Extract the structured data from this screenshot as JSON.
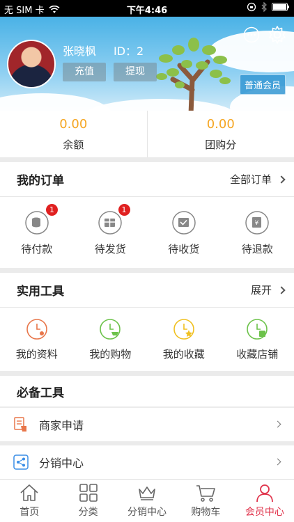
{
  "status_bar": {
    "carrier": "无 SIM 卡",
    "time": "下午4:46"
  },
  "profile": {
    "name": "张晓枫",
    "id_label": "ID：2",
    "recharge_label": "充值",
    "withdraw_label": "提现",
    "member_level": "普通会员"
  },
  "balance": [
    {
      "value": "0.00",
      "label": "余额"
    },
    {
      "value": "0.00",
      "label": "团购分"
    }
  ],
  "orders": {
    "title": "我的订单",
    "more_label": "全部订单",
    "items": [
      {
        "label": "待付款",
        "icon": "wallet-icon",
        "badge": "1"
      },
      {
        "label": "待发货",
        "icon": "package-icon",
        "badge": "1"
      },
      {
        "label": "待收货",
        "icon": "receive-icon",
        "badge": ""
      },
      {
        "label": "待退款",
        "icon": "refund-icon",
        "badge": ""
      }
    ]
  },
  "tools": {
    "title": "实用工具",
    "more_label": "展开",
    "items": [
      {
        "label": "我的资料",
        "icon": "profile-icon",
        "color": "#e8764a"
      },
      {
        "label": "我的购物",
        "icon": "shopping-icon",
        "color": "#6cc24a"
      },
      {
        "label": "我的收藏",
        "icon": "favorite-icon",
        "color": "#f0c020"
      },
      {
        "label": "收藏店铺",
        "icon": "store-icon",
        "color": "#6cc24a"
      }
    ]
  },
  "essentials": {
    "title": "必备工具",
    "items": [
      {
        "label": "商家申请",
        "icon": "merchant-icon"
      },
      {
        "label": "分销中心",
        "icon": "distribution-icon"
      }
    ]
  },
  "tabbar": {
    "items": [
      {
        "label": "首页",
        "icon": "home-icon"
      },
      {
        "label": "分类",
        "icon": "category-icon"
      },
      {
        "label": "分销中心",
        "icon": "crown-icon"
      },
      {
        "label": "购物车",
        "icon": "cart-icon"
      },
      {
        "label": "会员中心",
        "icon": "member-icon",
        "active": true
      }
    ]
  },
  "colors": {
    "accent": "#e0334b",
    "balance": "#f5a623",
    "header": "#4ab2e6"
  }
}
